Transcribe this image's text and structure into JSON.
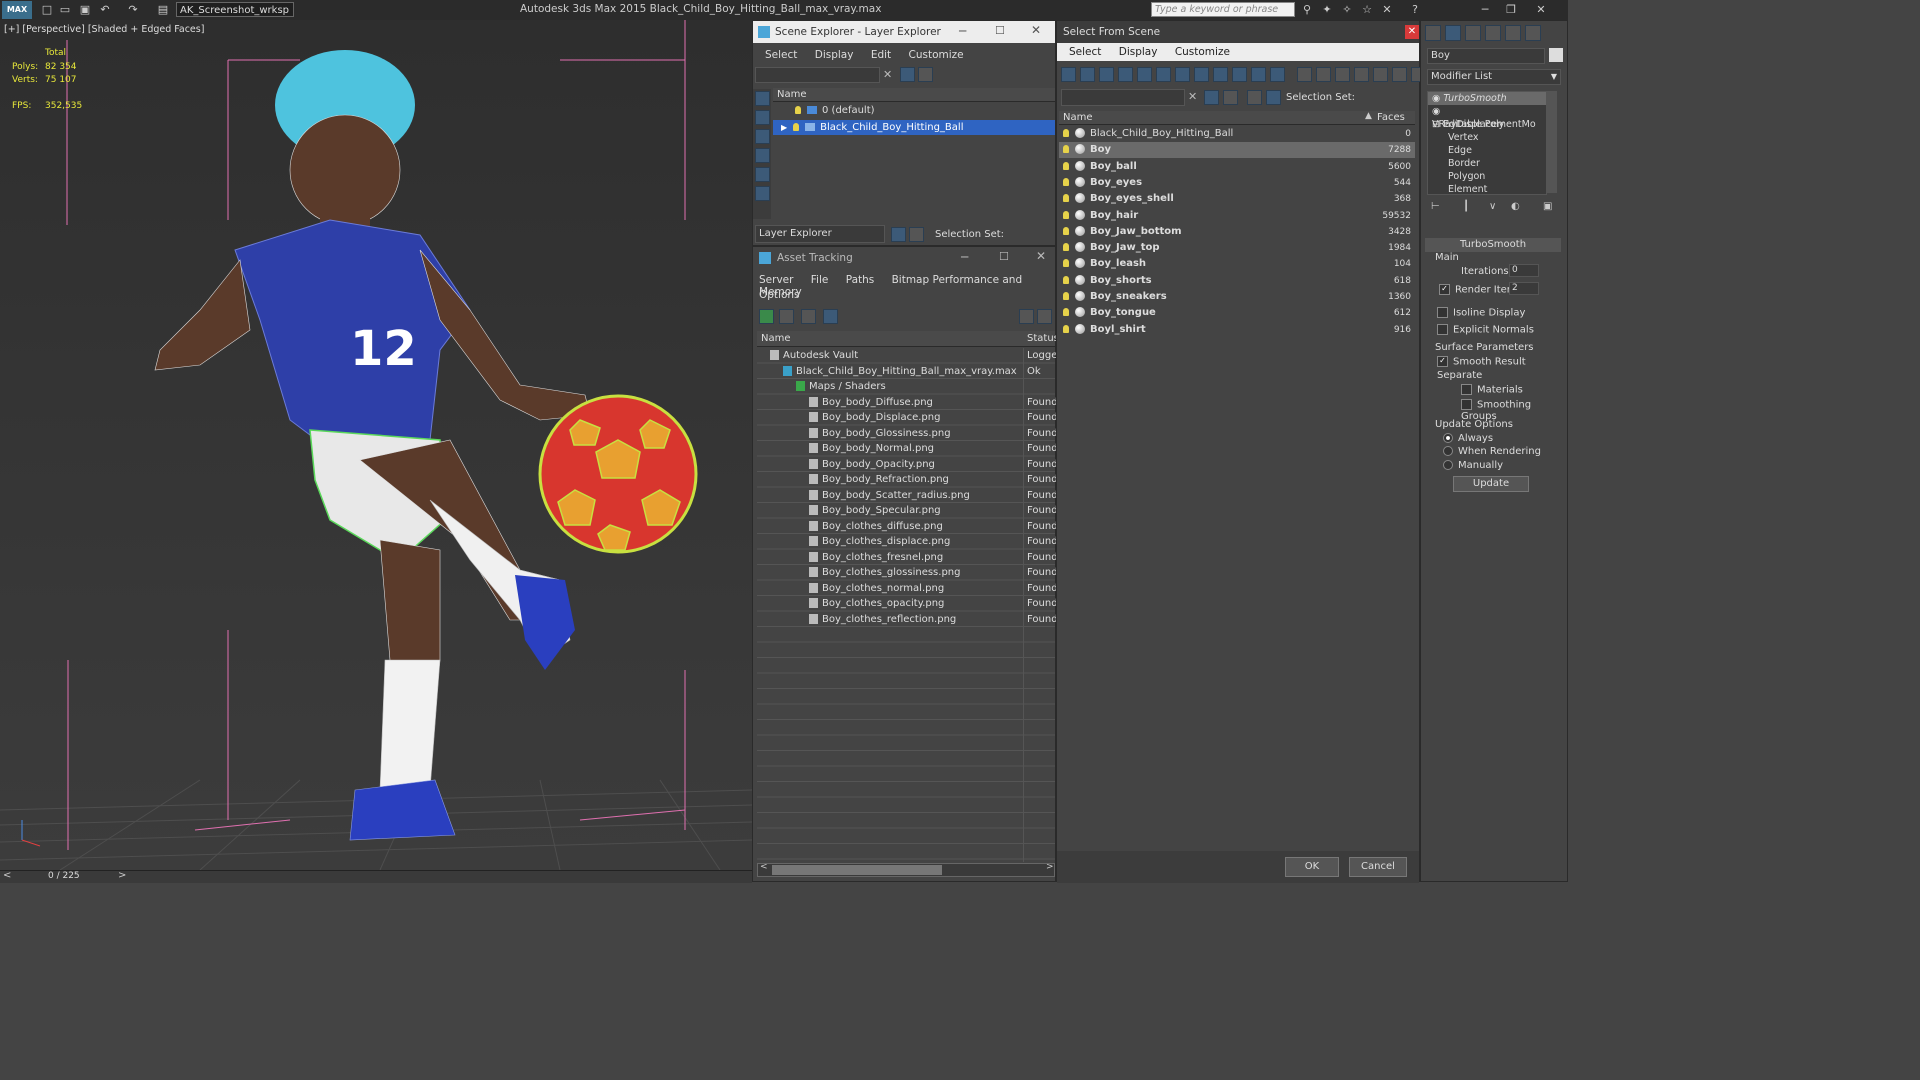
{
  "titlebar": {
    "logo": "MAX",
    "workspace": "AK_Screenshot_wrksp",
    "title": "Autodesk 3ds Max  2015     Black_Child_Boy_Hitting_Ball_max_vray.max",
    "search_placeholder": "Type a keyword or phrase"
  },
  "viewport": {
    "label": "[+] [Perspective] [Shaded + Edged Faces]",
    "stats_total": "Total",
    "polys_label": "Polys:",
    "polys_value": "82 354",
    "verts_label": "Verts:",
    "verts_value": "75 107",
    "fps_label": "FPS:",
    "fps_value": "352,535"
  },
  "timeline": {
    "frame": "0 / 225"
  },
  "scene_explorer": {
    "title": "Scene Explorer - Layer Explorer",
    "menu": [
      "Select",
      "Display",
      "Edit",
      "Customize"
    ],
    "column_name": "Name",
    "layers": [
      {
        "name": "0 (default)",
        "selected": false
      },
      {
        "name": "Black_Child_Boy_Hitting_Ball",
        "selected": true
      }
    ],
    "footer_dropdown": "Layer Explorer",
    "selection_set": "Selection Set:"
  },
  "asset_tracking": {
    "title": "Asset Tracking",
    "menu": [
      "Server",
      "File",
      "Paths",
      "Bitmap Performance and Memory"
    ],
    "menu2": "Options",
    "col_name": "Name",
    "col_status": "Status",
    "rows": [
      {
        "name": "Autodesk Vault",
        "status": "Logge",
        "indent": 1
      },
      {
        "name": "Black_Child_Boy_Hitting_Ball_max_vray.max",
        "status": "Ok",
        "indent": 2
      },
      {
        "name": "Maps / Shaders",
        "status": "",
        "indent": 3
      },
      {
        "name": "Boy_body_Diffuse.png",
        "status": "Found",
        "indent": 4
      },
      {
        "name": "Boy_body_Displace.png",
        "status": "Found",
        "indent": 4
      },
      {
        "name": "Boy_body_Glossiness.png",
        "status": "Found",
        "indent": 4
      },
      {
        "name": "Boy_body_Normal.png",
        "status": "Found",
        "indent": 4
      },
      {
        "name": "Boy_body_Opacity.png",
        "status": "Found",
        "indent": 4
      },
      {
        "name": "Boy_body_Refraction.png",
        "status": "Found",
        "indent": 4
      },
      {
        "name": "Boy_body_Scatter_radius.png",
        "status": "Found",
        "indent": 4
      },
      {
        "name": "Boy_body_Specular.png",
        "status": "Found",
        "indent": 4
      },
      {
        "name": "Boy_clothes_diffuse.png",
        "status": "Found",
        "indent": 4
      },
      {
        "name": "Boy_clothes_displace.png",
        "status": "Found",
        "indent": 4
      },
      {
        "name": "Boy_clothes_fresnel.png",
        "status": "Found",
        "indent": 4
      },
      {
        "name": "Boy_clothes_glossiness.png",
        "status": "Found",
        "indent": 4
      },
      {
        "name": "Boy_clothes_normal.png",
        "status": "Found",
        "indent": 4
      },
      {
        "name": "Boy_clothes_opacity.png",
        "status": "Found",
        "indent": 4
      },
      {
        "name": "Boy_clothes_reflection.png",
        "status": "Found",
        "indent": 4
      }
    ]
  },
  "select_from_scene": {
    "title": "Select From Scene",
    "menu": [
      "Select",
      "Display",
      "Customize"
    ],
    "selection_set": "Selection Set:",
    "col_name": "Name",
    "col_faces": "Faces",
    "objects": [
      {
        "name": "Black_Child_Boy_Hitting_Ball",
        "faces": "0",
        "selected": false
      },
      {
        "name": "Boy",
        "faces": "7288",
        "selected": true
      },
      {
        "name": "Boy_ball",
        "faces": "5600",
        "selected": false
      },
      {
        "name": "Boy_eyes",
        "faces": "544",
        "selected": false
      },
      {
        "name": "Boy_eyes_shell",
        "faces": "368",
        "selected": false
      },
      {
        "name": "Boy_hair",
        "faces": "59532",
        "selected": false
      },
      {
        "name": "Boy_Jaw_bottom",
        "faces": "3428",
        "selected": false
      },
      {
        "name": "Boy_Jaw_top",
        "faces": "1984",
        "selected": false
      },
      {
        "name": "Boy_leash",
        "faces": "104",
        "selected": false
      },
      {
        "name": "Boy_shorts",
        "faces": "618",
        "selected": false
      },
      {
        "name": "Boy_sneakers",
        "faces": "1360",
        "selected": false
      },
      {
        "name": "Boy_tongue",
        "faces": "612",
        "selected": false
      },
      {
        "name": "Boyl_shirt",
        "faces": "916",
        "selected": false
      }
    ],
    "ok": "OK",
    "cancel": "Cancel"
  },
  "command_panel": {
    "object_name": "Boy",
    "modifier_list": "Modifier List",
    "stack": [
      {
        "name": "TurboSmooth",
        "level": 0,
        "italic": true
      },
      {
        "name": "VRayDisplacementMo",
        "level": 0,
        "italic": false
      },
      {
        "name": "Editable Poly",
        "level": 0,
        "italic": false
      },
      {
        "name": "Vertex",
        "level": 1,
        "italic": false
      },
      {
        "name": "Edge",
        "level": 1,
        "italic": false
      },
      {
        "name": "Border",
        "level": 1,
        "italic": false
      },
      {
        "name": "Polygon",
        "level": 1,
        "italic": false
      },
      {
        "name": "Element",
        "level": 1,
        "italic": false
      }
    ],
    "rollout": "TurboSmooth",
    "main": "Main",
    "iterations_label": "Iterations:",
    "iterations": "0",
    "render_iters_label": "Render Iters:",
    "render_iters": "2",
    "isoline": "Isoline Display",
    "explicit_normals": "Explicit Normals",
    "surface_params": "Surface Parameters",
    "smooth_result": "Smooth Result",
    "separate": "Separate",
    "materials": "Materials",
    "smoothing_groups": "Smoothing Groups",
    "update_options": "Update Options",
    "always": "Always",
    "when_rendering": "When Rendering",
    "manually": "Manually",
    "update": "Update"
  },
  "colors": {
    "selection": "#2f64c2",
    "selected_row": "#6a6a6a",
    "stats": "#e8e83a",
    "viewport_bg": "#353535"
  }
}
